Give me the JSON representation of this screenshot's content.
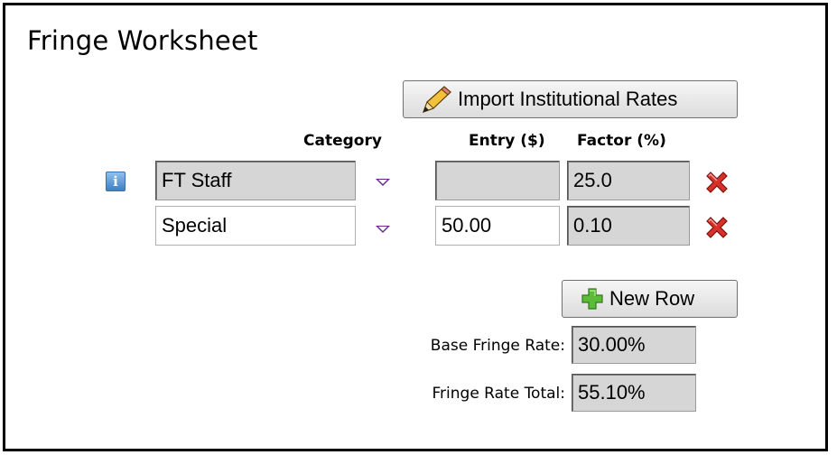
{
  "worksheet": {
    "title": "Fringe Worksheet"
  },
  "toolbar": {
    "import_label": "Import Institutional Rates",
    "new_row_label": "New Row"
  },
  "table": {
    "headers": {
      "category": "Category",
      "entry": "Entry ($)",
      "factor": "Factor (%)"
    },
    "rows": [
      {
        "category": "FT Staff",
        "entry": "",
        "factor": "25.0"
      },
      {
        "category": "Special",
        "entry": "50.00",
        "factor": "0.10"
      }
    ]
  },
  "summary": {
    "base_label": "Base Fringe Rate:",
    "base_value": "30.00%",
    "total_label": "Fringe Rate Total:",
    "total_value": "55.10%"
  },
  "icons": {
    "import": "pencil-icon",
    "new_row": "plus-icon",
    "delete": "delete-x-icon",
    "info": "info-icon",
    "dropdown": "dropdown-arrow-icon"
  }
}
